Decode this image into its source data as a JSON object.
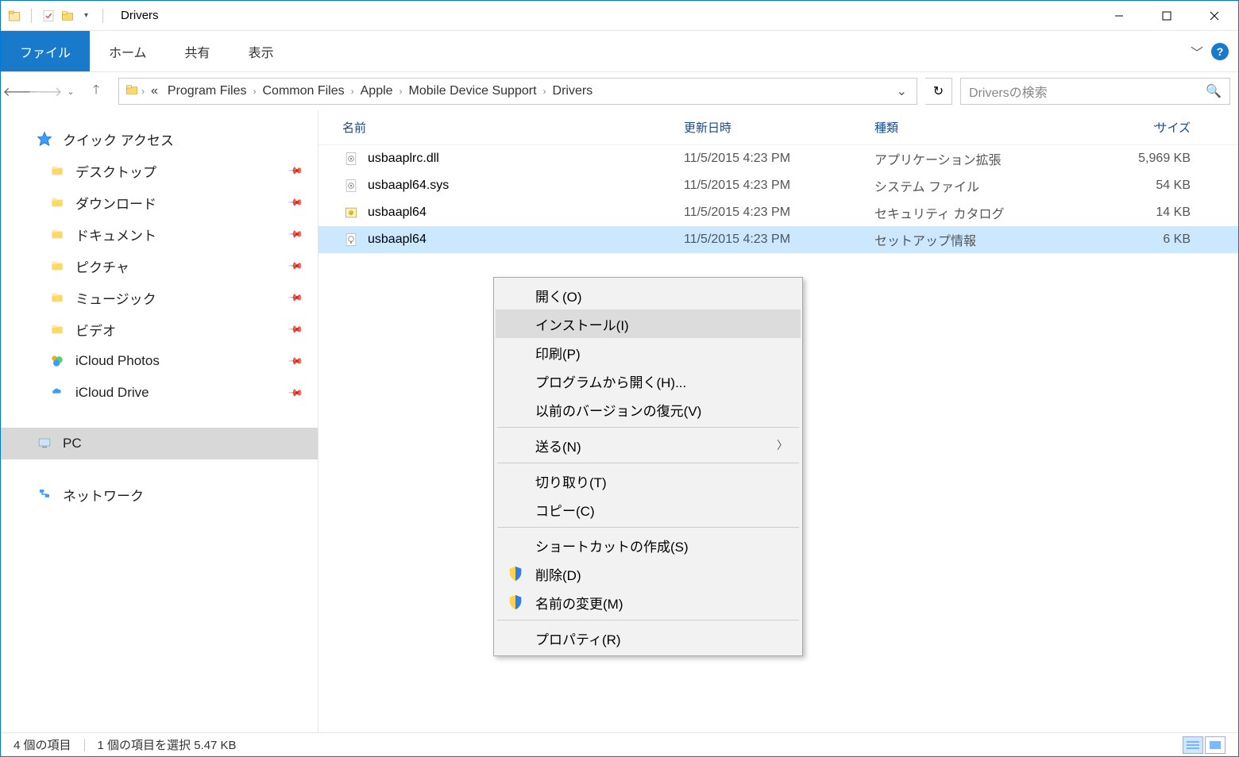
{
  "window": {
    "title": "Drivers"
  },
  "ribbon": {
    "file": "ファイル",
    "home": "ホーム",
    "share": "共有",
    "view": "表示"
  },
  "breadcrumb": {
    "items": [
      "Program Files",
      "Common Files",
      "Apple",
      "Mobile Device Support",
      "Drivers"
    ],
    "prefix": "«"
  },
  "search": {
    "placeholder": "Driversの検索"
  },
  "sidebar": {
    "quick_access": "クイック アクセス",
    "items": [
      {
        "label": "デスクトップ",
        "icon": "folder"
      },
      {
        "label": "ダウンロード",
        "icon": "folder"
      },
      {
        "label": "ドキュメント",
        "icon": "folder"
      },
      {
        "label": "ピクチャ",
        "icon": "folder"
      },
      {
        "label": "ミュージック",
        "icon": "folder"
      },
      {
        "label": "ビデオ",
        "icon": "folder"
      },
      {
        "label": "iCloud Photos",
        "icon": "cloud-photos"
      },
      {
        "label": "iCloud Drive",
        "icon": "cloud"
      }
    ],
    "pc": "PC",
    "network": "ネットワーク"
  },
  "columns": {
    "name": "名前",
    "date": "更新日時",
    "type": "種類",
    "size": "サイズ"
  },
  "files": [
    {
      "name": "usbaaplrc.dll",
      "date": "11/5/2015 4:23 PM",
      "type": "アプリケーション拡張",
      "size": "5,969 KB",
      "icon": "dll"
    },
    {
      "name": "usbaapl64.sys",
      "date": "11/5/2015 4:23 PM",
      "type": "システム ファイル",
      "size": "54 KB",
      "icon": "sys"
    },
    {
      "name": "usbaapl64",
      "date": "11/5/2015 4:23 PM",
      "type": "セキュリティ カタログ",
      "size": "14 KB",
      "icon": "catalog"
    },
    {
      "name": "usbaapl64",
      "date": "11/5/2015 4:23 PM",
      "type": "セットアップ情報",
      "size": "6 KB",
      "icon": "inf",
      "selected": true
    }
  ],
  "context_menu": {
    "open": "開く(O)",
    "install": "インストール(I)",
    "print": "印刷(P)",
    "open_with": "プログラムから開く(H)...",
    "restore": "以前のバージョンの復元(V)",
    "send_to": "送る(N)",
    "cut": "切り取り(T)",
    "copy": "コピー(C)",
    "shortcut": "ショートカットの作成(S)",
    "delete": "削除(D)",
    "rename": "名前の変更(M)",
    "properties": "プロパティ(R)"
  },
  "status": {
    "count": "4 個の項目",
    "selection": "1 個の項目を選択 5.47 KB"
  }
}
